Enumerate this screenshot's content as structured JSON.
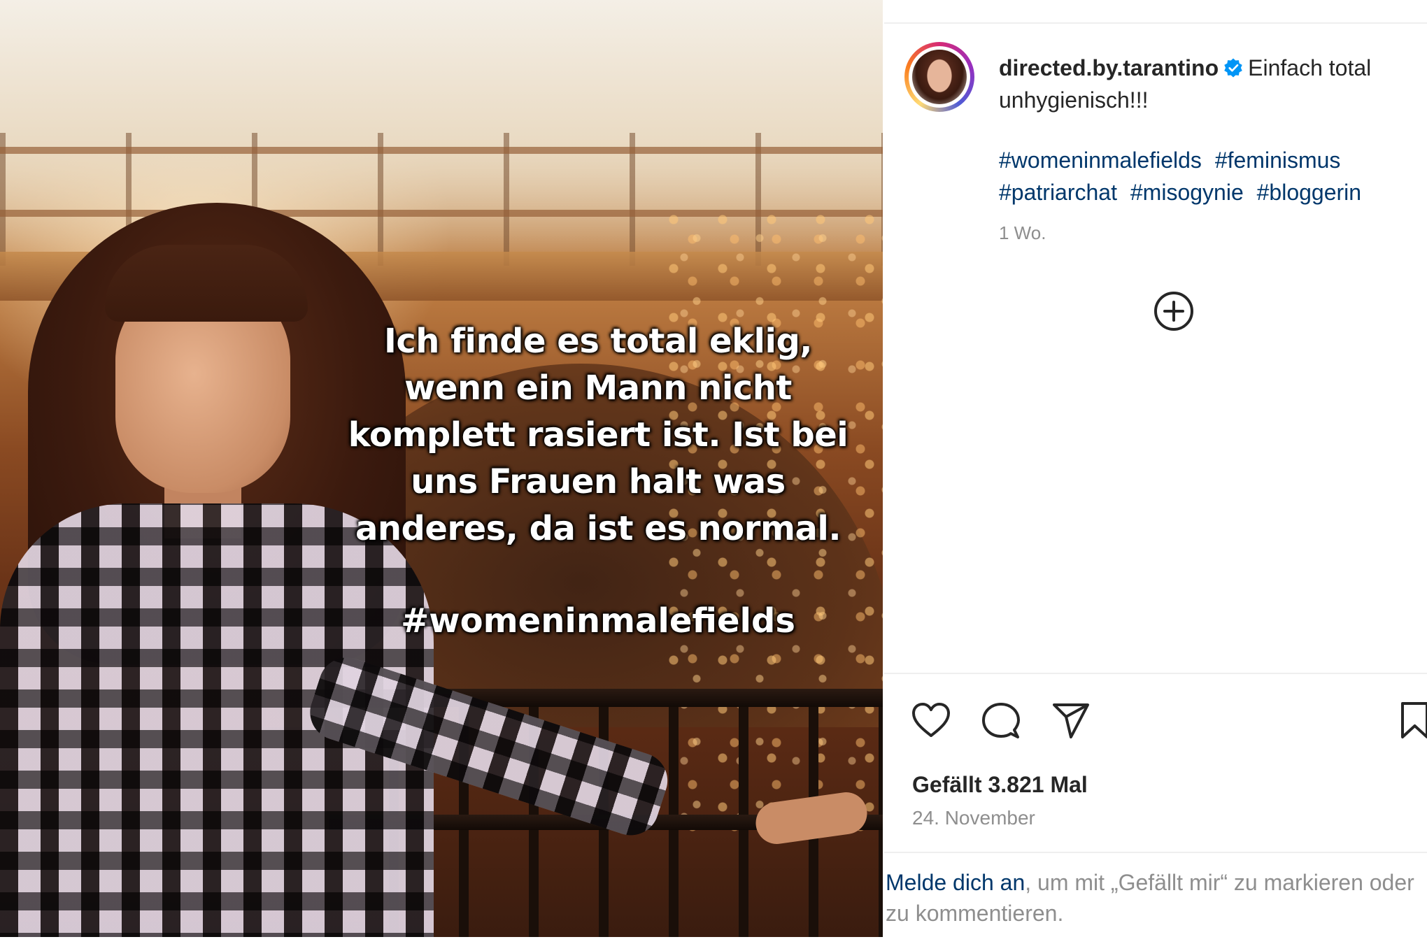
{
  "post": {
    "overlay_text": "Ich finde es total eklig, wenn ein Mann nicht komplett rasiert ist. Ist bei uns Frauen halt was anderes, da ist es normal.",
    "overlay_hashtag": "#womeninmalefields"
  },
  "header": {
    "username": "directed.by.tarantino",
    "verified_icon": "verified-badge-icon",
    "caption": "Einfach total unhygienisch!!!"
  },
  "hashtags": [
    "#womeninmalefields",
    "#feminismus",
    "#patriarchat",
    "#misogynie",
    "#bloggerin"
  ],
  "time_ago": "1 Wo.",
  "actions": {
    "like_icon": "heart-icon",
    "comment_icon": "comment-icon",
    "share_icon": "paper-plane-icon",
    "save_icon": "bookmark-icon",
    "more_comments_icon": "plus-circle-icon"
  },
  "likes": "Gefällt 3.821 Mal",
  "date": "24. November",
  "login": {
    "link": "Melde dich an",
    "rest": ", um mit „Gefällt mir“ zu markieren oder zu kommentieren."
  },
  "colors": {
    "link": "#00376b",
    "text": "#262626",
    "muted": "#8e8e8e",
    "verified": "#0095f6"
  }
}
